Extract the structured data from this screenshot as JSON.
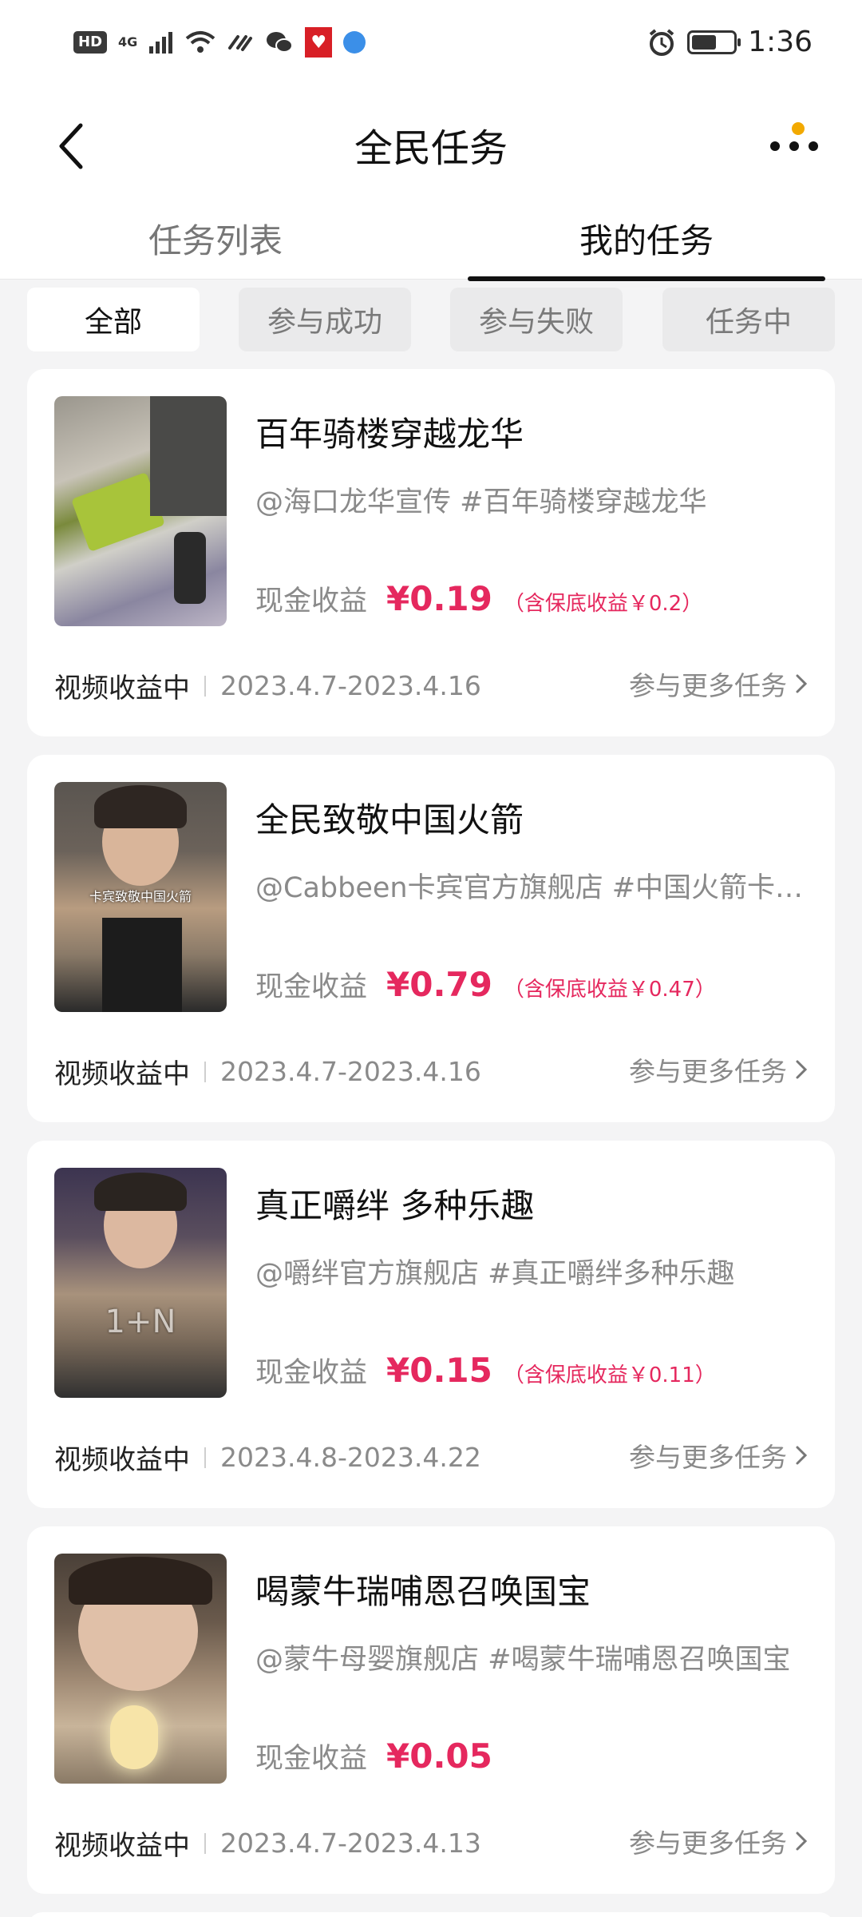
{
  "status_bar": {
    "hd": "HD",
    "net": "4G",
    "time": "1:36",
    "battery_level": 0.6
  },
  "header": {
    "title": "全民任务"
  },
  "tabs": [
    {
      "label": "任务列表",
      "active": false
    },
    {
      "label": "我的任务",
      "active": true
    }
  ],
  "filters": [
    {
      "label": "全部",
      "active": true
    },
    {
      "label": "参与成功",
      "active": false
    },
    {
      "label": "参与失败",
      "active": false
    },
    {
      "label": "任务中",
      "active": false
    }
  ],
  "tasks": [
    {
      "title": "百年骑楼穿越龙华",
      "desc": "@海口龙华宣传 #百年骑楼穿越龙华",
      "earn_label": "现金收益",
      "earn_value": "¥0.19",
      "earn_note": "（含保底收益￥0.2）",
      "status": "视频收益中",
      "date": "2023.4.7-2023.4.16",
      "more": "参与更多任务",
      "thumb_text": ""
    },
    {
      "title": "全民致敬中国火箭",
      "desc": "@Cabbeen卡宾官方旗舰店 #中国火箭卡宾致敬中国火箭",
      "earn_label": "现金收益",
      "earn_value": "¥0.79",
      "earn_note": "（含保底收益￥0.47）",
      "status": "视频收益中",
      "date": "2023.4.7-2023.4.16",
      "more": "参与更多任务",
      "thumb_text": "卡宾致敬中国火箭"
    },
    {
      "title": "真正嚼绊 多种乐趣",
      "desc": "@嚼绊官方旗舰店 #真正嚼绊多种乐趣",
      "earn_label": "现金收益",
      "earn_value": "¥0.15",
      "earn_note": "（含保底收益￥0.11）",
      "status": "视频收益中",
      "date": "2023.4.8-2023.4.22",
      "more": "参与更多任务",
      "thumb_text": "1+N"
    },
    {
      "title": "喝蒙牛瑞哺恩召唤国宝",
      "desc": "@蒙牛母婴旗舰店 #喝蒙牛瑞哺恩召唤国宝",
      "earn_label": "现金收益",
      "earn_value": "¥0.05",
      "earn_note": "",
      "status": "视频收益中",
      "date": "2023.4.7-2023.4.13",
      "more": "参与更多任务",
      "thumb_text": ""
    }
  ]
}
